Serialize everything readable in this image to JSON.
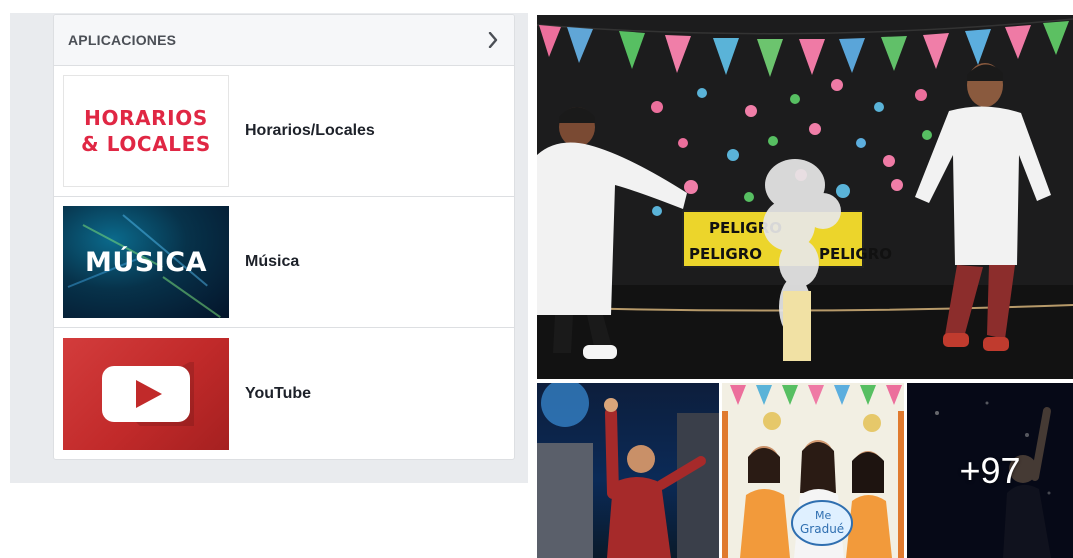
{
  "apps_panel": {
    "title": "APLICACIONES",
    "items": [
      {
        "label": "Horarios/Locales",
        "thumb_text": [
          "HORARIOS",
          "& LOCALES"
        ]
      },
      {
        "label": "Música",
        "thumb_text": "MÚSICA"
      },
      {
        "label": "YouTube",
        "thumb_icon": "youtube-play-icon"
      }
    ]
  },
  "photos": {
    "main_sign_text": [
      "PELIGRO",
      "PELIGRO",
      "PELIGRO"
    ],
    "graduate_sign_text": [
      "Me",
      "Gradué"
    ],
    "more_count": "+97"
  },
  "colors": {
    "brand_red": "#e02744",
    "youtube_red": "#c12a2a",
    "panel_bg": "#e9ebee"
  }
}
